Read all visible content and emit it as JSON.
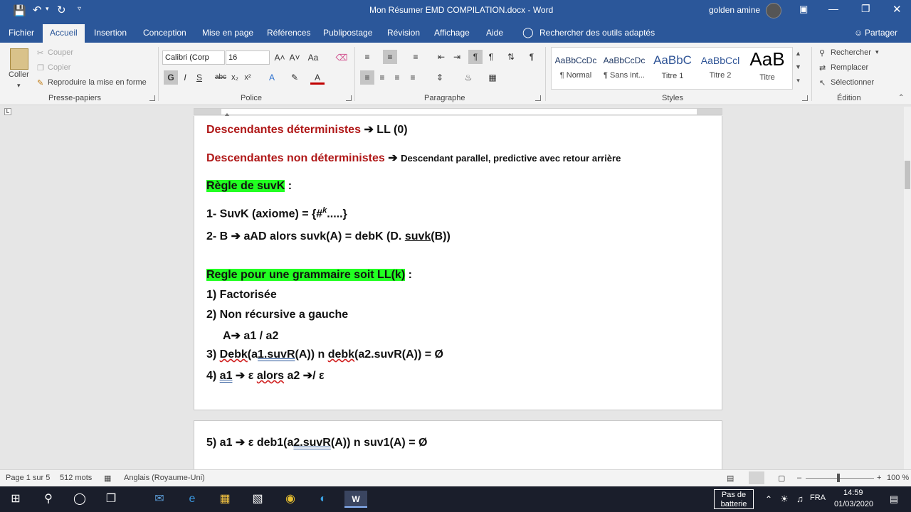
{
  "window": {
    "title": "Mon Résumer EMD COMPILATION.docx  -  Word",
    "user": "golden amine"
  },
  "tabs": [
    "Fichier",
    "Accueil",
    "Insertion",
    "Conception",
    "Mise en page",
    "Références",
    "Publipostage",
    "Révision",
    "Affichage",
    "Aide"
  ],
  "tell_me": "Rechercher des outils adaptés",
  "share": "Partager",
  "clipboard": {
    "paste": "Coller",
    "cut": "Couper",
    "copy": "Copier",
    "format_painter": "Reproduire la mise en forme",
    "group": "Presse-papiers"
  },
  "font": {
    "name": "Calibri (Corp",
    "size": "16",
    "group": "Police"
  },
  "paragraph": {
    "group": "Paragraphe"
  },
  "styles": {
    "group": "Styles",
    "items": [
      {
        "preview": "AaBbCcDc",
        "name": "¶ Normal"
      },
      {
        "preview": "AaBbCcDc",
        "name": "¶ Sans int..."
      },
      {
        "preview": "AaBbC",
        "name": "Titre 1"
      },
      {
        "preview": "AaBbCcl",
        "name": "Titre 2"
      },
      {
        "preview": "AaB",
        "name": "Titre"
      }
    ]
  },
  "editing": {
    "find": "Rechercher",
    "replace": "Remplacer",
    "select": "Sélectionner",
    "group": "Édition"
  },
  "doc": {
    "l1a": "Descendantes déterministes",
    "l1b": "LL (0)",
    "l2a": "Descendantes non déterministes",
    "l2b": "Descendant parallel, predictive avec retour arrière",
    "l3a": "Règle de suvK",
    "l3b": " :",
    "l4a": "1-  SuvK (axiome) = {#",
    "l4sup": "k",
    "l4b": ".....}",
    "l5a": "2-  B ",
    "l5b": " aAD alors ",
    "l5c": "suvk",
    "l5d": "(A) = debK (D. ",
    "l5e": "suvk",
    "l5f": "(B))",
    "l6a": "Regle pour une grammaire soit LL(k)",
    "l6b": " :",
    "l7": "1)  Factorisée",
    "l8": "2)  Non récursive a gauche",
    "l9a": "A",
    "l9b": " a1 / a2",
    "l10a": "3)  ",
    "l10b": "Debk",
    "l10c": "(a",
    "l10d": "1.suvR",
    "l10e": "(A)) n ",
    "l10f": "debk",
    "l10g": "(a2.suvR(A)) = Ø",
    "l11a": "4)  ",
    "l11b": "a1",
    "l11c": " ε ",
    "l11d": "alors",
    "l11e": " a2 ",
    "l11f": "/ ε",
    "l12a": "5)  a1 ",
    "l12b": " ε   deb1(a",
    "l12c": "2.suvR",
    "l12d": "(A)) n suv1(A) = Ø"
  },
  "status": {
    "page": "Page 1 sur 5",
    "words": "512 mots",
    "language": "Anglais (Royaume-Uni)",
    "zoom": "100 %"
  },
  "taskbar": {
    "battery": "Pas de batterie",
    "lang": "FRA",
    "time": "14:59",
    "date": "01/03/2020"
  }
}
